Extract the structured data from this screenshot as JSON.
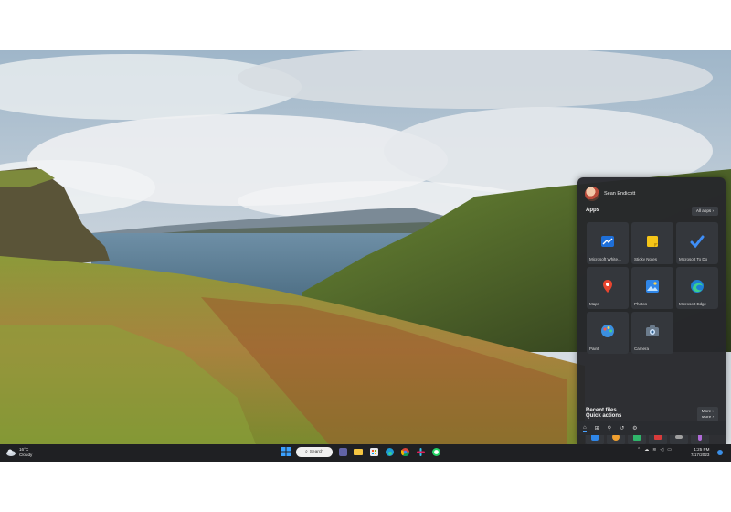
{
  "start": {
    "user_name": "Sean Endicott",
    "apps_title": "Apps",
    "all_apps": "All apps",
    "apps": [
      {
        "label": "Microsoft White...",
        "icon": "whiteboard-icon",
        "color": "#1e6fd9"
      },
      {
        "label": "Sticky Notes",
        "icon": "sticky-notes-icon",
        "color": "#f5c518"
      },
      {
        "label": "Microsoft To Do",
        "icon": "todo-icon",
        "color": "#3f8ef7"
      },
      {
        "label": "Maps",
        "icon": "maps-icon",
        "color": "#e8452f"
      },
      {
        "label": "Photos",
        "icon": "photos-icon",
        "color": "#2f86e8"
      },
      {
        "label": "Microsoft Edge",
        "icon": "edge-icon",
        "color": "#2fb5a8"
      },
      {
        "label": "Paint",
        "icon": "paint-icon",
        "color": "#3b8fe0"
      },
      {
        "label": "Camera",
        "icon": "camera-icon",
        "color": "#6b7b8c"
      }
    ],
    "quick_actions_title": "Quick actions",
    "quick_more": "More",
    "quick_actions": [
      {
        "icon": "qa-app-icon",
        "color": "#2f86e8"
      },
      {
        "icon": "qa-emoji-icon",
        "color": "#f0a030"
      },
      {
        "icon": "qa-store-icon",
        "color": "#2fb56a"
      },
      {
        "icon": "qa-record-icon",
        "color": "#d83b3b"
      },
      {
        "icon": "qa-controller-icon",
        "color": "#a0a0a0"
      },
      {
        "icon": "qa-podcast-icon",
        "color": "#b06ad8"
      }
    ],
    "recent_title": "Recent files",
    "recent_more": "More"
  },
  "taskbar": {
    "weather_temp": "16°C",
    "weather_desc": "Cloudy",
    "search_label": "Search",
    "time": "1:25 PM",
    "date": "7/17/2023"
  }
}
